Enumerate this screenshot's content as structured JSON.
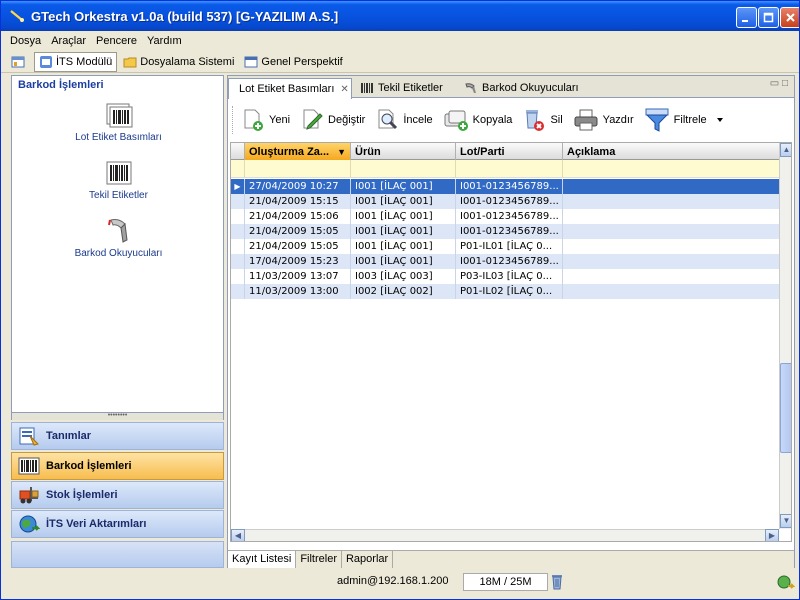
{
  "window": {
    "title": "GTech Orkestra v1.0a (build 537) [G-YAZILIM A.S.]"
  },
  "menu": [
    "Dosya",
    "Araçlar",
    "Pencere",
    "Yardım"
  ],
  "perspectives": [
    {
      "label": "İTS Modülü",
      "active": true
    },
    {
      "label": "Dosyalama Sistemi",
      "active": false
    },
    {
      "label": "Genel Perspektif",
      "active": false
    }
  ],
  "left": {
    "title": "Barkod İşlemleri",
    "items": [
      "Lot Etiket Basımları",
      "Tekil Etiketler",
      "Barkod Okuyucuları"
    ]
  },
  "nav": [
    {
      "label": "Tanımlar",
      "active": false
    },
    {
      "label": "Barkod İşlemleri",
      "active": true
    },
    {
      "label": "Stok İşlemleri",
      "active": false
    },
    {
      "label": "İTS Veri Aktarımları",
      "active": false
    }
  ],
  "tabs": [
    {
      "label": "Lot Etiket Basımları",
      "active": true
    },
    {
      "label": "Tekil Etiketler",
      "active": false
    },
    {
      "label": "Barkod Okuyucuları",
      "active": false
    }
  ],
  "toolbar": {
    "new": "Yeni",
    "edit": "Değiştir",
    "inspect": "İncele",
    "copy": "Kopyala",
    "delete": "Sil",
    "print": "Yazdır",
    "filter": "Filtrele"
  },
  "table": {
    "columns": [
      "Oluşturma Za...",
      "Ürün",
      "Lot/Parti",
      "Açıklama"
    ],
    "rows": [
      [
        "27/04/2009 10:27",
        "I001 [İLAÇ 001]",
        "I001-0123456789...",
        ""
      ],
      [
        "21/04/2009 15:15",
        "I001 [İLAÇ 001]",
        "I001-0123456789...",
        ""
      ],
      [
        "21/04/2009 15:06",
        "I001 [İLAÇ 001]",
        "I001-0123456789...",
        ""
      ],
      [
        "21/04/2009 15:05",
        "I001 [İLAÇ 001]",
        "I001-0123456789...",
        ""
      ],
      [
        "21/04/2009 15:05",
        "I001 [İLAÇ 001]",
        "P01-IL01 [İLAÇ 0...",
        ""
      ],
      [
        "17/04/2009 15:23",
        "I001 [İLAÇ 001]",
        "I001-0123456789...",
        ""
      ],
      [
        "11/03/2009 13:07",
        "I003 [İLAÇ 003]",
        "P03-IL03 [İLAÇ 0...",
        ""
      ],
      [
        "11/03/2009 13:00",
        "I002 [İLAÇ 002]",
        "P01-IL02 [İLAÇ 0...",
        ""
      ]
    ],
    "selected_index": 0
  },
  "bottom_tabs": [
    {
      "label": "Kayıt Listesi",
      "active": true
    },
    {
      "label": "Filtreler",
      "active": false
    },
    {
      "label": "Raporlar",
      "active": false
    }
  ],
  "status": {
    "user": "admin@192.168.1.200",
    "memory": "18M / 25M"
  },
  "colors": {
    "selection": "#316ac5",
    "active_nav": "#f8bd4e",
    "title_bar": "#0853e0"
  }
}
